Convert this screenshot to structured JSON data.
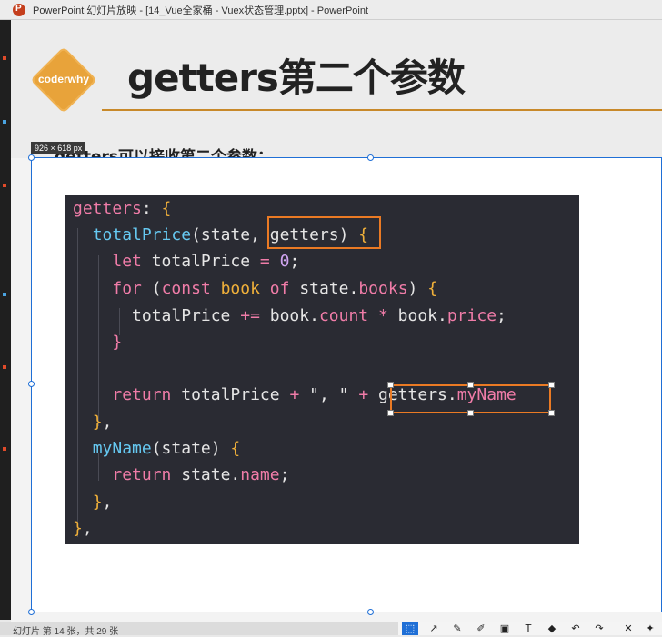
{
  "window": {
    "title": "PowerPoint 幻灯片放映 - [14_Vue全家桶 - Vuex状态管理.pptx] - PowerPoint"
  },
  "slide": {
    "logo_text": "coderwhy",
    "title": "getters第二个参数",
    "bullet": "getters可以接收第二个参数："
  },
  "image": {
    "size_tooltip": "926 × 618  px"
  },
  "code": {
    "lines": [
      "getters: {",
      "  totalPrice(state, getters) {",
      "    let totalPrice = 0;",
      "    for (const book of state.books) {",
      "      totalPrice += book.count * book.price;",
      "    }",
      "",
      "    return totalPrice + \", \" + getters.myName",
      "  },",
      "  myName(state) {",
      "    return state.name;",
      "  },",
      "},"
    ]
  },
  "status": {
    "slide_info": "幻灯片 第 14 张，共 29 张"
  },
  "toolbar": {
    "icons": [
      "select-icon",
      "chart-icon",
      "pen-icon",
      "highlighter-icon",
      "crop-icon",
      "text-icon",
      "eraser-icon",
      "undo-icon",
      "redo-icon",
      "close-icon",
      "pin-icon"
    ]
  },
  "colors": {
    "accent": "#e8a33a",
    "selection": "#1f6fd6",
    "highlight_box": "#ea7a24",
    "code_bg": "#2a2b33"
  }
}
